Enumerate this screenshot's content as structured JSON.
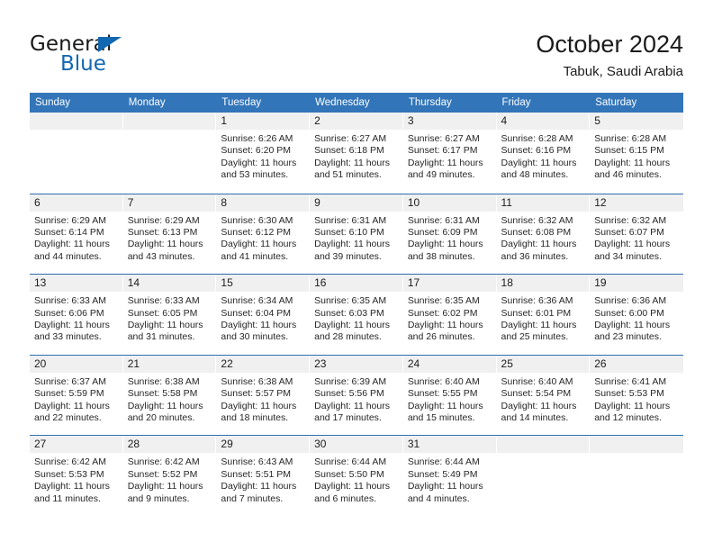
{
  "brand": {
    "name_part1": "General",
    "name_part2": "Blue",
    "accent_color": "#1267b1",
    "triangle_icon": "triangle-icon"
  },
  "header": {
    "title": "October 2024",
    "subtitle": "Tabuk, Saudi Arabia"
  },
  "calendar": {
    "header_bg": "#3275b9",
    "header_text_color": "#ffffff",
    "row_divider_color": "#2e6fae",
    "day_band_bg": "#f0f0f0",
    "weekdays": [
      "Sunday",
      "Monday",
      "Tuesday",
      "Wednesday",
      "Thursday",
      "Friday",
      "Saturday"
    ],
    "weeks": [
      [
        {
          "day": "",
          "sunrise": "",
          "sunset": "",
          "daylight_line1": "",
          "daylight_line2": ""
        },
        {
          "day": "",
          "sunrise": "",
          "sunset": "",
          "daylight_line1": "",
          "daylight_line2": ""
        },
        {
          "day": "1",
          "sunrise": "Sunrise: 6:26 AM",
          "sunset": "Sunset: 6:20 PM",
          "daylight_line1": "Daylight: 11 hours",
          "daylight_line2": "and 53 minutes."
        },
        {
          "day": "2",
          "sunrise": "Sunrise: 6:27 AM",
          "sunset": "Sunset: 6:18 PM",
          "daylight_line1": "Daylight: 11 hours",
          "daylight_line2": "and 51 minutes."
        },
        {
          "day": "3",
          "sunrise": "Sunrise: 6:27 AM",
          "sunset": "Sunset: 6:17 PM",
          "daylight_line1": "Daylight: 11 hours",
          "daylight_line2": "and 49 minutes."
        },
        {
          "day": "4",
          "sunrise": "Sunrise: 6:28 AM",
          "sunset": "Sunset: 6:16 PM",
          "daylight_line1": "Daylight: 11 hours",
          "daylight_line2": "and 48 minutes."
        },
        {
          "day": "5",
          "sunrise": "Sunrise: 6:28 AM",
          "sunset": "Sunset: 6:15 PM",
          "daylight_line1": "Daylight: 11 hours",
          "daylight_line2": "and 46 minutes."
        }
      ],
      [
        {
          "day": "6",
          "sunrise": "Sunrise: 6:29 AM",
          "sunset": "Sunset: 6:14 PM",
          "daylight_line1": "Daylight: 11 hours",
          "daylight_line2": "and 44 minutes."
        },
        {
          "day": "7",
          "sunrise": "Sunrise: 6:29 AM",
          "sunset": "Sunset: 6:13 PM",
          "daylight_line1": "Daylight: 11 hours",
          "daylight_line2": "and 43 minutes."
        },
        {
          "day": "8",
          "sunrise": "Sunrise: 6:30 AM",
          "sunset": "Sunset: 6:12 PM",
          "daylight_line1": "Daylight: 11 hours",
          "daylight_line2": "and 41 minutes."
        },
        {
          "day": "9",
          "sunrise": "Sunrise: 6:31 AM",
          "sunset": "Sunset: 6:10 PM",
          "daylight_line1": "Daylight: 11 hours",
          "daylight_line2": "and 39 minutes."
        },
        {
          "day": "10",
          "sunrise": "Sunrise: 6:31 AM",
          "sunset": "Sunset: 6:09 PM",
          "daylight_line1": "Daylight: 11 hours",
          "daylight_line2": "and 38 minutes."
        },
        {
          "day": "11",
          "sunrise": "Sunrise: 6:32 AM",
          "sunset": "Sunset: 6:08 PM",
          "daylight_line1": "Daylight: 11 hours",
          "daylight_line2": "and 36 minutes."
        },
        {
          "day": "12",
          "sunrise": "Sunrise: 6:32 AM",
          "sunset": "Sunset: 6:07 PM",
          "daylight_line1": "Daylight: 11 hours",
          "daylight_line2": "and 34 minutes."
        }
      ],
      [
        {
          "day": "13",
          "sunrise": "Sunrise: 6:33 AM",
          "sunset": "Sunset: 6:06 PM",
          "daylight_line1": "Daylight: 11 hours",
          "daylight_line2": "and 33 minutes."
        },
        {
          "day": "14",
          "sunrise": "Sunrise: 6:33 AM",
          "sunset": "Sunset: 6:05 PM",
          "daylight_line1": "Daylight: 11 hours",
          "daylight_line2": "and 31 minutes."
        },
        {
          "day": "15",
          "sunrise": "Sunrise: 6:34 AM",
          "sunset": "Sunset: 6:04 PM",
          "daylight_line1": "Daylight: 11 hours",
          "daylight_line2": "and 30 minutes."
        },
        {
          "day": "16",
          "sunrise": "Sunrise: 6:35 AM",
          "sunset": "Sunset: 6:03 PM",
          "daylight_line1": "Daylight: 11 hours",
          "daylight_line2": "and 28 minutes."
        },
        {
          "day": "17",
          "sunrise": "Sunrise: 6:35 AM",
          "sunset": "Sunset: 6:02 PM",
          "daylight_line1": "Daylight: 11 hours",
          "daylight_line2": "and 26 minutes."
        },
        {
          "day": "18",
          "sunrise": "Sunrise: 6:36 AM",
          "sunset": "Sunset: 6:01 PM",
          "daylight_line1": "Daylight: 11 hours",
          "daylight_line2": "and 25 minutes."
        },
        {
          "day": "19",
          "sunrise": "Sunrise: 6:36 AM",
          "sunset": "Sunset: 6:00 PM",
          "daylight_line1": "Daylight: 11 hours",
          "daylight_line2": "and 23 minutes."
        }
      ],
      [
        {
          "day": "20",
          "sunrise": "Sunrise: 6:37 AM",
          "sunset": "Sunset: 5:59 PM",
          "daylight_line1": "Daylight: 11 hours",
          "daylight_line2": "and 22 minutes."
        },
        {
          "day": "21",
          "sunrise": "Sunrise: 6:38 AM",
          "sunset": "Sunset: 5:58 PM",
          "daylight_line1": "Daylight: 11 hours",
          "daylight_line2": "and 20 minutes."
        },
        {
          "day": "22",
          "sunrise": "Sunrise: 6:38 AM",
          "sunset": "Sunset: 5:57 PM",
          "daylight_line1": "Daylight: 11 hours",
          "daylight_line2": "and 18 minutes."
        },
        {
          "day": "23",
          "sunrise": "Sunrise: 6:39 AM",
          "sunset": "Sunset: 5:56 PM",
          "daylight_line1": "Daylight: 11 hours",
          "daylight_line2": "and 17 minutes."
        },
        {
          "day": "24",
          "sunrise": "Sunrise: 6:40 AM",
          "sunset": "Sunset: 5:55 PM",
          "daylight_line1": "Daylight: 11 hours",
          "daylight_line2": "and 15 minutes."
        },
        {
          "day": "25",
          "sunrise": "Sunrise: 6:40 AM",
          "sunset": "Sunset: 5:54 PM",
          "daylight_line1": "Daylight: 11 hours",
          "daylight_line2": "and 14 minutes."
        },
        {
          "day": "26",
          "sunrise": "Sunrise: 6:41 AM",
          "sunset": "Sunset: 5:53 PM",
          "daylight_line1": "Daylight: 11 hours",
          "daylight_line2": "and 12 minutes."
        }
      ],
      [
        {
          "day": "27",
          "sunrise": "Sunrise: 6:42 AM",
          "sunset": "Sunset: 5:53 PM",
          "daylight_line1": "Daylight: 11 hours",
          "daylight_line2": "and 11 minutes."
        },
        {
          "day": "28",
          "sunrise": "Sunrise: 6:42 AM",
          "sunset": "Sunset: 5:52 PM",
          "daylight_line1": "Daylight: 11 hours",
          "daylight_line2": "and 9 minutes."
        },
        {
          "day": "29",
          "sunrise": "Sunrise: 6:43 AM",
          "sunset": "Sunset: 5:51 PM",
          "daylight_line1": "Daylight: 11 hours",
          "daylight_line2": "and 7 minutes."
        },
        {
          "day": "30",
          "sunrise": "Sunrise: 6:44 AM",
          "sunset": "Sunset: 5:50 PM",
          "daylight_line1": "Daylight: 11 hours",
          "daylight_line2": "and 6 minutes."
        },
        {
          "day": "31",
          "sunrise": "Sunrise: 6:44 AM",
          "sunset": "Sunset: 5:49 PM",
          "daylight_line1": "Daylight: 11 hours",
          "daylight_line2": "and 4 minutes."
        },
        {
          "day": "",
          "sunrise": "",
          "sunset": "",
          "daylight_line1": "",
          "daylight_line2": ""
        },
        {
          "day": "",
          "sunrise": "",
          "sunset": "",
          "daylight_line1": "",
          "daylight_line2": ""
        }
      ]
    ]
  }
}
